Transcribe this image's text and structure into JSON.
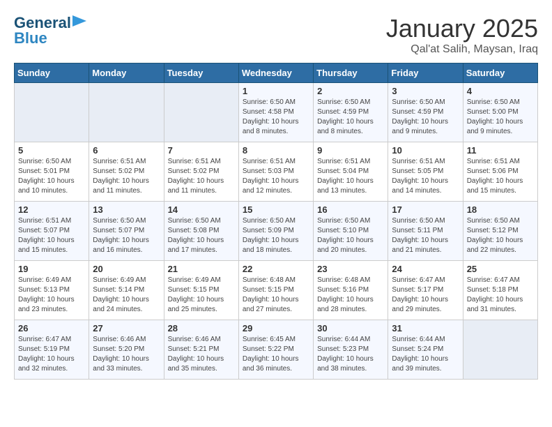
{
  "header": {
    "logo_line1": "General",
    "logo_line2": "Blue",
    "title": "January 2025",
    "subtitle": "Qal'at Salih, Maysan, Iraq"
  },
  "weekdays": [
    "Sunday",
    "Monday",
    "Tuesday",
    "Wednesday",
    "Thursday",
    "Friday",
    "Saturday"
  ],
  "weeks": [
    [
      {
        "day": "",
        "info": ""
      },
      {
        "day": "",
        "info": ""
      },
      {
        "day": "",
        "info": ""
      },
      {
        "day": "1",
        "info": "Sunrise: 6:50 AM\nSunset: 4:58 PM\nDaylight: 10 hours\nand 8 minutes."
      },
      {
        "day": "2",
        "info": "Sunrise: 6:50 AM\nSunset: 4:59 PM\nDaylight: 10 hours\nand 8 minutes."
      },
      {
        "day": "3",
        "info": "Sunrise: 6:50 AM\nSunset: 4:59 PM\nDaylight: 10 hours\nand 9 minutes."
      },
      {
        "day": "4",
        "info": "Sunrise: 6:50 AM\nSunset: 5:00 PM\nDaylight: 10 hours\nand 9 minutes."
      }
    ],
    [
      {
        "day": "5",
        "info": "Sunrise: 6:50 AM\nSunset: 5:01 PM\nDaylight: 10 hours\nand 10 minutes."
      },
      {
        "day": "6",
        "info": "Sunrise: 6:51 AM\nSunset: 5:02 PM\nDaylight: 10 hours\nand 11 minutes."
      },
      {
        "day": "7",
        "info": "Sunrise: 6:51 AM\nSunset: 5:02 PM\nDaylight: 10 hours\nand 11 minutes."
      },
      {
        "day": "8",
        "info": "Sunrise: 6:51 AM\nSunset: 5:03 PM\nDaylight: 10 hours\nand 12 minutes."
      },
      {
        "day": "9",
        "info": "Sunrise: 6:51 AM\nSunset: 5:04 PM\nDaylight: 10 hours\nand 13 minutes."
      },
      {
        "day": "10",
        "info": "Sunrise: 6:51 AM\nSunset: 5:05 PM\nDaylight: 10 hours\nand 14 minutes."
      },
      {
        "day": "11",
        "info": "Sunrise: 6:51 AM\nSunset: 5:06 PM\nDaylight: 10 hours\nand 15 minutes."
      }
    ],
    [
      {
        "day": "12",
        "info": "Sunrise: 6:51 AM\nSunset: 5:07 PM\nDaylight: 10 hours\nand 15 minutes."
      },
      {
        "day": "13",
        "info": "Sunrise: 6:50 AM\nSunset: 5:07 PM\nDaylight: 10 hours\nand 16 minutes."
      },
      {
        "day": "14",
        "info": "Sunrise: 6:50 AM\nSunset: 5:08 PM\nDaylight: 10 hours\nand 17 minutes."
      },
      {
        "day": "15",
        "info": "Sunrise: 6:50 AM\nSunset: 5:09 PM\nDaylight: 10 hours\nand 18 minutes."
      },
      {
        "day": "16",
        "info": "Sunrise: 6:50 AM\nSunset: 5:10 PM\nDaylight: 10 hours\nand 20 minutes."
      },
      {
        "day": "17",
        "info": "Sunrise: 6:50 AM\nSunset: 5:11 PM\nDaylight: 10 hours\nand 21 minutes."
      },
      {
        "day": "18",
        "info": "Sunrise: 6:50 AM\nSunset: 5:12 PM\nDaylight: 10 hours\nand 22 minutes."
      }
    ],
    [
      {
        "day": "19",
        "info": "Sunrise: 6:49 AM\nSunset: 5:13 PM\nDaylight: 10 hours\nand 23 minutes."
      },
      {
        "day": "20",
        "info": "Sunrise: 6:49 AM\nSunset: 5:14 PM\nDaylight: 10 hours\nand 24 minutes."
      },
      {
        "day": "21",
        "info": "Sunrise: 6:49 AM\nSunset: 5:15 PM\nDaylight: 10 hours\nand 25 minutes."
      },
      {
        "day": "22",
        "info": "Sunrise: 6:48 AM\nSunset: 5:15 PM\nDaylight: 10 hours\nand 27 minutes."
      },
      {
        "day": "23",
        "info": "Sunrise: 6:48 AM\nSunset: 5:16 PM\nDaylight: 10 hours\nand 28 minutes."
      },
      {
        "day": "24",
        "info": "Sunrise: 6:47 AM\nSunset: 5:17 PM\nDaylight: 10 hours\nand 29 minutes."
      },
      {
        "day": "25",
        "info": "Sunrise: 6:47 AM\nSunset: 5:18 PM\nDaylight: 10 hours\nand 31 minutes."
      }
    ],
    [
      {
        "day": "26",
        "info": "Sunrise: 6:47 AM\nSunset: 5:19 PM\nDaylight: 10 hours\nand 32 minutes."
      },
      {
        "day": "27",
        "info": "Sunrise: 6:46 AM\nSunset: 5:20 PM\nDaylight: 10 hours\nand 33 minutes."
      },
      {
        "day": "28",
        "info": "Sunrise: 6:46 AM\nSunset: 5:21 PM\nDaylight: 10 hours\nand 35 minutes."
      },
      {
        "day": "29",
        "info": "Sunrise: 6:45 AM\nSunset: 5:22 PM\nDaylight: 10 hours\nand 36 minutes."
      },
      {
        "day": "30",
        "info": "Sunrise: 6:44 AM\nSunset: 5:23 PM\nDaylight: 10 hours\nand 38 minutes."
      },
      {
        "day": "31",
        "info": "Sunrise: 6:44 AM\nSunset: 5:24 PM\nDaylight: 10 hours\nand 39 minutes."
      },
      {
        "day": "",
        "info": ""
      }
    ]
  ]
}
